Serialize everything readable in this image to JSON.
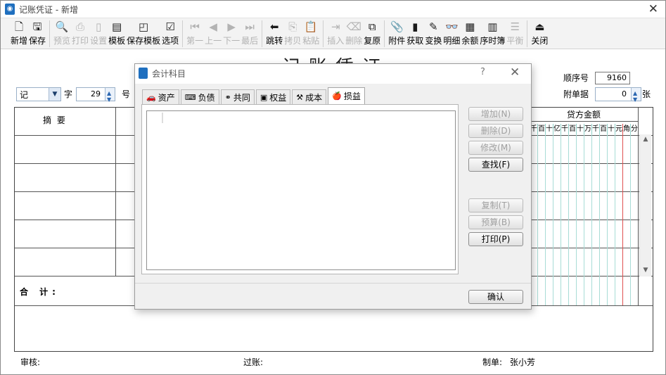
{
  "window": {
    "title": "记账凭证 - 新增",
    "close_glyph": "✕"
  },
  "toolbar": [
    {
      "label": "新增",
      "icon": "new-doc-icon",
      "glyph": "🗋",
      "enabled": true
    },
    {
      "label": "保存",
      "icon": "save-icon",
      "glyph": "🖫",
      "enabled": true
    },
    {
      "sep": true
    },
    {
      "label": "预览",
      "icon": "preview-icon",
      "glyph": "🔍",
      "enabled": false
    },
    {
      "label": "打印",
      "icon": "print-icon",
      "glyph": "⎙",
      "enabled": false
    },
    {
      "label": "设置",
      "icon": "page-setup-icon",
      "glyph": "▯",
      "enabled": false
    },
    {
      "label": "模板",
      "icon": "template-icon",
      "glyph": "▤",
      "enabled": true
    },
    {
      "label": "保存模板",
      "icon": "save-template-icon",
      "glyph": "◰",
      "enabled": true
    },
    {
      "label": "选项",
      "icon": "options-icon",
      "glyph": "☑",
      "enabled": true
    },
    {
      "sep": true
    },
    {
      "label": "第一",
      "icon": "first-icon",
      "glyph": "⏮",
      "enabled": false
    },
    {
      "label": "上一",
      "icon": "prev-icon",
      "glyph": "◀",
      "enabled": false
    },
    {
      "label": "下一",
      "icon": "next-icon",
      "glyph": "▶",
      "enabled": false
    },
    {
      "label": "最后",
      "icon": "last-icon",
      "glyph": "⏭",
      "enabled": false
    },
    {
      "sep": true
    },
    {
      "label": "跳转",
      "icon": "jump-icon",
      "glyph": "⬅",
      "enabled": true
    },
    {
      "label": "拷贝",
      "icon": "copy-icon",
      "glyph": "⎘",
      "enabled": false
    },
    {
      "label": "粘贴",
      "icon": "paste-icon",
      "glyph": "📋",
      "enabled": false
    },
    {
      "sep": true
    },
    {
      "label": "插入",
      "icon": "insert-row-icon",
      "glyph": "⇥",
      "enabled": false
    },
    {
      "label": "删除",
      "icon": "delete-row-icon",
      "glyph": "⌫",
      "enabled": false
    },
    {
      "label": "复原",
      "icon": "restore-icon",
      "glyph": "⧉",
      "enabled": true
    },
    {
      "sep": true
    },
    {
      "label": "附件",
      "icon": "attachment-icon",
      "glyph": "📎",
      "enabled": true
    },
    {
      "label": "获取",
      "icon": "fetch-icon",
      "glyph": "▮",
      "enabled": true
    },
    {
      "label": "变换",
      "icon": "transform-icon",
      "glyph": "✎",
      "enabled": true
    },
    {
      "label": "明细",
      "icon": "binoculars-icon",
      "glyph": "👓",
      "enabled": true
    },
    {
      "label": "余额",
      "icon": "balance-icon",
      "glyph": "▦",
      "enabled": true
    },
    {
      "label": "序时簿",
      "icon": "journal-icon",
      "glyph": "▥",
      "enabled": true
    },
    {
      "label": "平衡",
      "icon": "balance-check-icon",
      "glyph": "☰",
      "enabled": false
    },
    {
      "sep": true
    },
    {
      "label": "关闭",
      "icon": "exit-icon",
      "glyph": "⏏",
      "enabled": true
    }
  ],
  "voucher": {
    "big_title": "记账凭证",
    "type_value": "记",
    "zi_label": "字",
    "number_value": "29",
    "hao_label": "号",
    "seq_label": "顺序号",
    "seq_value": "9160",
    "attach_label": "附单据",
    "attach_value": "0",
    "zhang_label": "张",
    "col_summary": "摘  要",
    "col_credit": "贷方金额",
    "digits": [
      "千",
      "百",
      "十",
      "亿",
      "千",
      "百",
      "十",
      "万",
      "千",
      "百",
      "十",
      "元",
      "角",
      "分"
    ],
    "total_label": "合 计:",
    "footer": {
      "audit": "审核:",
      "posting": "过账:",
      "maker_label": "制单:",
      "maker_value": "张小芳"
    }
  },
  "dialog": {
    "title": "会计科目",
    "help": "?",
    "close": "✕",
    "tabs": [
      {
        "label": "资产",
        "icon": "car-icon",
        "glyph": "🚗",
        "active": false
      },
      {
        "label": "负债",
        "icon": "keyboard-icon",
        "glyph": "⌨",
        "active": false
      },
      {
        "label": "共同",
        "icon": "shared-icon",
        "glyph": "⚭",
        "active": false
      },
      {
        "label": "权益",
        "icon": "equity-icon",
        "glyph": "▣",
        "active": false
      },
      {
        "label": "成本",
        "icon": "cost-icon",
        "glyph": "⚒",
        "active": false
      },
      {
        "label": "损益",
        "icon": "apple-icon",
        "glyph": "🍎",
        "active": true
      }
    ],
    "buttons": [
      {
        "name": "add-button",
        "label": "增加(N)",
        "enabled": false
      },
      {
        "name": "delete-button",
        "label": "删除(D)",
        "enabled": false
      },
      {
        "name": "modify-button",
        "label": "修改(M)",
        "enabled": false
      },
      {
        "name": "find-button",
        "label": "查找(F)",
        "enabled": true
      },
      {
        "name": "copy-button",
        "label": "复制(T)",
        "enabled": false
      },
      {
        "name": "budget-button",
        "label": "预算(B)",
        "enabled": false
      },
      {
        "name": "print-button",
        "label": "打印(P)",
        "enabled": true
      }
    ],
    "ok_label": "确认"
  }
}
